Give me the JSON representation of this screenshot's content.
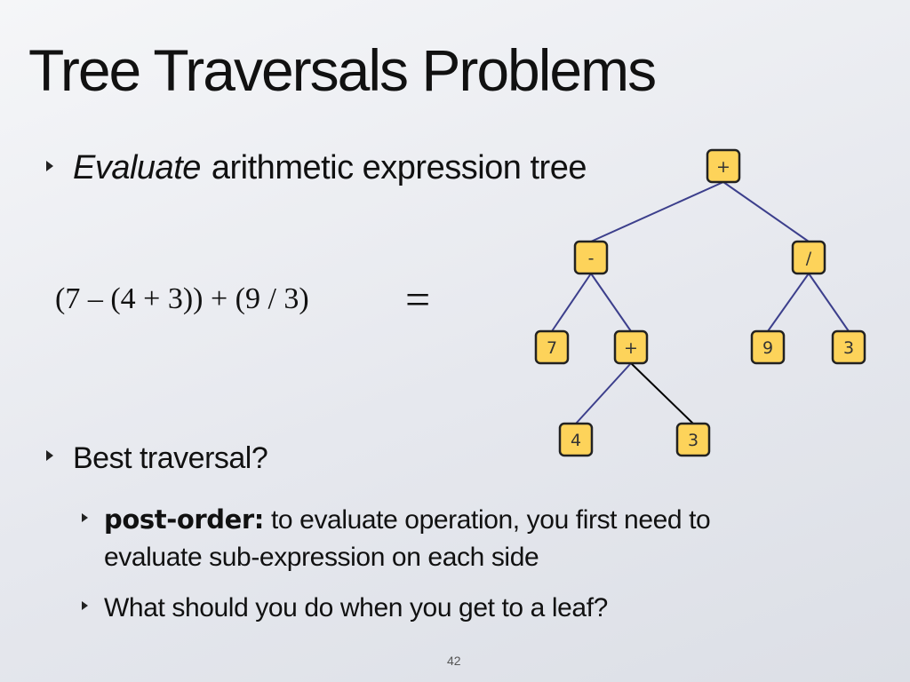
{
  "title": "Tree Traversals Problems",
  "bullets": [
    {
      "emphasis": "Evaluate",
      "text": "arithmetic expression tree"
    },
    {
      "text": "Best traversal?"
    }
  ],
  "subbullets": [
    {
      "strong": "post-order:",
      "line1": "to evaluate operation, you first need to",
      "line2": "evaluate sub-expression on each side"
    },
    {
      "text": "What should you do when you get to a leaf?"
    }
  ],
  "expression": "(7 – (4 + 3)) + (9 / 3)",
  "equals_sign": "=",
  "tree": {
    "nodes": [
      {
        "id": "root",
        "label": "+"
      },
      {
        "id": "minus",
        "label": "-"
      },
      {
        "id": "div",
        "label": "/"
      },
      {
        "id": "seven",
        "label": "7"
      },
      {
        "id": "plus",
        "label": "+"
      },
      {
        "id": "nine",
        "label": "9"
      },
      {
        "id": "three-right",
        "label": "3"
      },
      {
        "id": "four",
        "label": "4"
      },
      {
        "id": "three-bottom",
        "label": "3"
      }
    ],
    "node_color": "#fdd35a",
    "node_border": "#222222",
    "edge_color": "#3c3f8c",
    "highlight_edge_color": "#000000"
  },
  "page_number": "42"
}
